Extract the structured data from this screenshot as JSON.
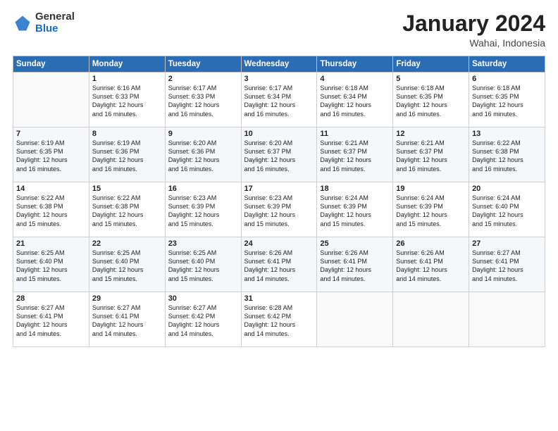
{
  "logo": {
    "general": "General",
    "blue": "Blue"
  },
  "header": {
    "title": "January 2024",
    "location": "Wahai, Indonesia"
  },
  "days_header": [
    "Sunday",
    "Monday",
    "Tuesday",
    "Wednesday",
    "Thursday",
    "Friday",
    "Saturday"
  ],
  "weeks": [
    [
      {
        "day": "",
        "info": ""
      },
      {
        "day": "1",
        "info": "Sunrise: 6:16 AM\nSunset: 6:33 PM\nDaylight: 12 hours\nand 16 minutes."
      },
      {
        "day": "2",
        "info": "Sunrise: 6:17 AM\nSunset: 6:33 PM\nDaylight: 12 hours\nand 16 minutes."
      },
      {
        "day": "3",
        "info": "Sunrise: 6:17 AM\nSunset: 6:34 PM\nDaylight: 12 hours\nand 16 minutes."
      },
      {
        "day": "4",
        "info": "Sunrise: 6:18 AM\nSunset: 6:34 PM\nDaylight: 12 hours\nand 16 minutes."
      },
      {
        "day": "5",
        "info": "Sunrise: 6:18 AM\nSunset: 6:35 PM\nDaylight: 12 hours\nand 16 minutes."
      },
      {
        "day": "6",
        "info": "Sunrise: 6:18 AM\nSunset: 6:35 PM\nDaylight: 12 hours\nand 16 minutes."
      }
    ],
    [
      {
        "day": "7",
        "info": "Sunrise: 6:19 AM\nSunset: 6:35 PM\nDaylight: 12 hours\nand 16 minutes."
      },
      {
        "day": "8",
        "info": "Sunrise: 6:19 AM\nSunset: 6:36 PM\nDaylight: 12 hours\nand 16 minutes."
      },
      {
        "day": "9",
        "info": "Sunrise: 6:20 AM\nSunset: 6:36 PM\nDaylight: 12 hours\nand 16 minutes."
      },
      {
        "day": "10",
        "info": "Sunrise: 6:20 AM\nSunset: 6:37 PM\nDaylight: 12 hours\nand 16 minutes."
      },
      {
        "day": "11",
        "info": "Sunrise: 6:21 AM\nSunset: 6:37 PM\nDaylight: 12 hours\nand 16 minutes."
      },
      {
        "day": "12",
        "info": "Sunrise: 6:21 AM\nSunset: 6:37 PM\nDaylight: 12 hours\nand 16 minutes."
      },
      {
        "day": "13",
        "info": "Sunrise: 6:22 AM\nSunset: 6:38 PM\nDaylight: 12 hours\nand 16 minutes."
      }
    ],
    [
      {
        "day": "14",
        "info": "Sunrise: 6:22 AM\nSunset: 6:38 PM\nDaylight: 12 hours\nand 15 minutes."
      },
      {
        "day": "15",
        "info": "Sunrise: 6:22 AM\nSunset: 6:38 PM\nDaylight: 12 hours\nand 15 minutes."
      },
      {
        "day": "16",
        "info": "Sunrise: 6:23 AM\nSunset: 6:39 PM\nDaylight: 12 hours\nand 15 minutes."
      },
      {
        "day": "17",
        "info": "Sunrise: 6:23 AM\nSunset: 6:39 PM\nDaylight: 12 hours\nand 15 minutes."
      },
      {
        "day": "18",
        "info": "Sunrise: 6:24 AM\nSunset: 6:39 PM\nDaylight: 12 hours\nand 15 minutes."
      },
      {
        "day": "19",
        "info": "Sunrise: 6:24 AM\nSunset: 6:39 PM\nDaylight: 12 hours\nand 15 minutes."
      },
      {
        "day": "20",
        "info": "Sunrise: 6:24 AM\nSunset: 6:40 PM\nDaylight: 12 hours\nand 15 minutes."
      }
    ],
    [
      {
        "day": "21",
        "info": "Sunrise: 6:25 AM\nSunset: 6:40 PM\nDaylight: 12 hours\nand 15 minutes."
      },
      {
        "day": "22",
        "info": "Sunrise: 6:25 AM\nSunset: 6:40 PM\nDaylight: 12 hours\nand 15 minutes."
      },
      {
        "day": "23",
        "info": "Sunrise: 6:25 AM\nSunset: 6:40 PM\nDaylight: 12 hours\nand 15 minutes."
      },
      {
        "day": "24",
        "info": "Sunrise: 6:26 AM\nSunset: 6:41 PM\nDaylight: 12 hours\nand 14 minutes."
      },
      {
        "day": "25",
        "info": "Sunrise: 6:26 AM\nSunset: 6:41 PM\nDaylight: 12 hours\nand 14 minutes."
      },
      {
        "day": "26",
        "info": "Sunrise: 6:26 AM\nSunset: 6:41 PM\nDaylight: 12 hours\nand 14 minutes."
      },
      {
        "day": "27",
        "info": "Sunrise: 6:27 AM\nSunset: 6:41 PM\nDaylight: 12 hours\nand 14 minutes."
      }
    ],
    [
      {
        "day": "28",
        "info": "Sunrise: 6:27 AM\nSunset: 6:41 PM\nDaylight: 12 hours\nand 14 minutes."
      },
      {
        "day": "29",
        "info": "Sunrise: 6:27 AM\nSunset: 6:41 PM\nDaylight: 12 hours\nand 14 minutes."
      },
      {
        "day": "30",
        "info": "Sunrise: 6:27 AM\nSunset: 6:42 PM\nDaylight: 12 hours\nand 14 minutes."
      },
      {
        "day": "31",
        "info": "Sunrise: 6:28 AM\nSunset: 6:42 PM\nDaylight: 12 hours\nand 14 minutes."
      },
      {
        "day": "",
        "info": ""
      },
      {
        "day": "",
        "info": ""
      },
      {
        "day": "",
        "info": ""
      }
    ]
  ]
}
